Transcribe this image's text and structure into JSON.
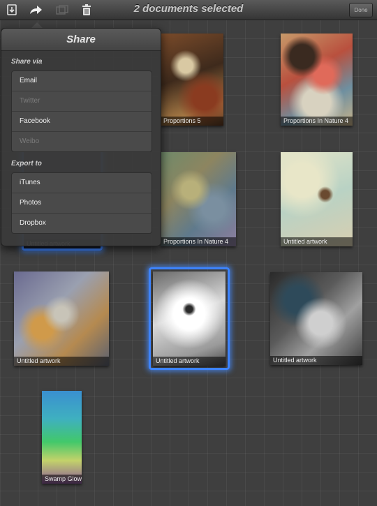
{
  "toolbar": {
    "title": "2 documents selected",
    "done_label": "Done",
    "icons": [
      "import-icon",
      "share-arrow-icon",
      "duplicate-icon",
      "trash-icon"
    ]
  },
  "share_popover": {
    "title": "Share",
    "share_via_label": "Share via",
    "share_via_items": [
      {
        "label": "Email",
        "enabled": true
      },
      {
        "label": "Twitter",
        "enabled": false
      },
      {
        "label": "Facebook",
        "enabled": true
      },
      {
        "label": "Weibo",
        "enabled": false
      }
    ],
    "export_to_label": "Export to",
    "export_items": [
      {
        "label": "iTunes",
        "enabled": true
      },
      {
        "label": "Photos",
        "enabled": true
      },
      {
        "label": "Dropbox",
        "enabled": true
      }
    ]
  },
  "gallery": {
    "artworks": [
      {
        "caption": "Proportions 5",
        "selected": false
      },
      {
        "caption": "Proportions In Nature 4",
        "selected": false
      },
      {
        "caption": "Untitled artwork",
        "selected": true
      },
      {
        "caption": "Proportions In Nature 4",
        "selected": false
      },
      {
        "caption": "Untitled artwork",
        "selected": false
      },
      {
        "caption": "Untitled artwork",
        "selected": false
      },
      {
        "caption": "Untitled artwork",
        "selected": true
      },
      {
        "caption": "Untitled artwork",
        "selected": false
      },
      {
        "caption": "Swamp Glow",
        "selected": false
      }
    ]
  },
  "colors": {
    "selection": "#3d84ff",
    "background": "#3f3f3f"
  }
}
